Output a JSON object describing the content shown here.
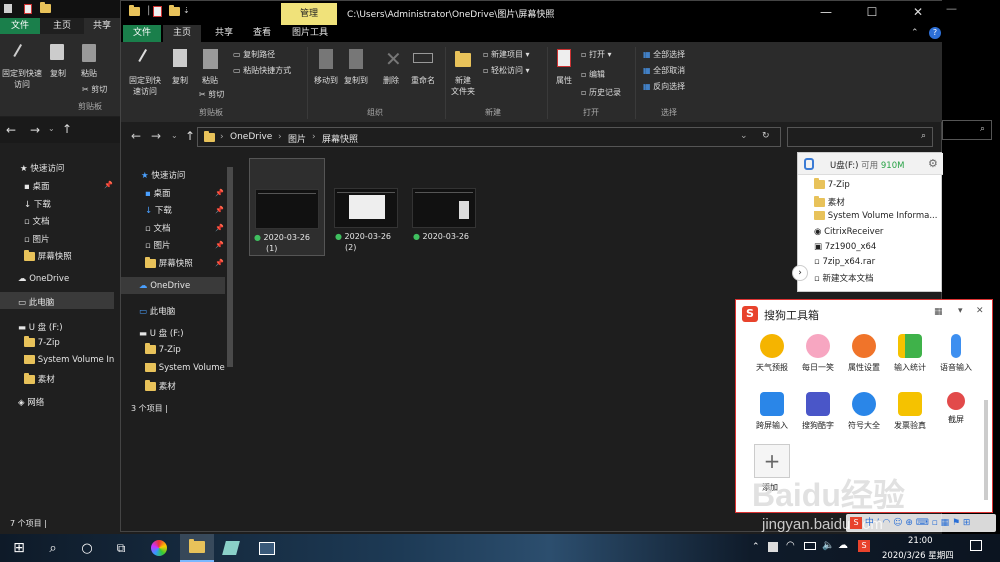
{
  "bg_window": {
    "tabs": [
      "文件",
      "主页",
      "共享"
    ],
    "ribbon": {
      "pin": "固定到快速访问",
      "copy": "复制",
      "paste": "粘贴",
      "cut": "剪切",
      "group": "剪贴板"
    },
    "nav": [
      "快速访问",
      "桌面",
      "下载",
      "文档",
      "图片",
      "屏幕快照",
      "OneDrive",
      "此电脑",
      "U 盘 (F:)",
      "7-Zip",
      "System Volume In",
      "素材",
      "网络"
    ],
    "status": "7 个项目"
  },
  "window": {
    "manage_tab": "管理",
    "path_title": "C:\\Users\\Administrator\\OneDrive\\图片\\屏幕快照",
    "tabs": [
      "文件",
      "主页",
      "共享",
      "查看",
      "图片工具"
    ],
    "ribbon": {
      "pin_l1": "固定到快",
      "pin_l2": "速访问",
      "copy": "复制",
      "paste": "粘贴",
      "copy_path": "复制路径",
      "paste_shortcut": "粘贴快捷方式",
      "cut": "剪切",
      "clipboard": "剪贴板",
      "move_to": "移动到",
      "copy_to": "复制到",
      "delete": "删除",
      "rename": "重命名",
      "organize": "组织",
      "new_folder_l1": "新建",
      "new_folder_l2": "文件夹",
      "new_item": "新建项目",
      "easy_access": "轻松访问",
      "new": "新建",
      "properties": "属性",
      "open": "打开",
      "edit": "编辑",
      "history": "历史记录",
      "open_group": "打开",
      "select_all": "全部选择",
      "select_none": "全部取消",
      "invert": "反向选择",
      "select": "选择"
    },
    "breadcrumb": [
      "OneDrive",
      "图片",
      "屏幕快照"
    ],
    "nav": {
      "quick_access": "快速访问",
      "desktop": "桌面",
      "downloads": "下载",
      "documents": "文档",
      "pictures": "图片",
      "screenshots": "屏幕快照",
      "onedrive": "OneDrive",
      "this_pc": "此电脑",
      "udisk": "U 盘 (F:)",
      "zip": "7-Zip",
      "sysvol": "System Volume",
      "sucai": "素材"
    },
    "files": [
      {
        "name": "2020-03-26",
        "sub": "(1)"
      },
      {
        "name": "2020-03-26",
        "sub": "(2)"
      },
      {
        "name": "2020-03-26",
        "sub": ""
      }
    ],
    "status": "3 个项目"
  },
  "usb_panel": {
    "title": "U盘(F:)",
    "avail_label": "可用",
    "avail": "910M",
    "items": [
      "7-Zip",
      "素材",
      "System Volume Informa...",
      "CitrixReceiver",
      "7z1900_x64",
      "7zip_x64.rar",
      "新建文本文档"
    ]
  },
  "sogou": {
    "title": "搜狗工具箱",
    "tools": [
      "天气预报",
      "每日一笑",
      "属性设置",
      "输入统计",
      "语音输入",
      "跨屏输入",
      "搜狗酷字",
      "符号大全",
      "发票验真",
      "截屏"
    ],
    "add": "添加"
  },
  "watermark": {
    "brand": "Baidu经验",
    "url": "jingyan.baidu.com"
  },
  "taskbar": {
    "time": "21:00",
    "date": "2020/3/26 星期四"
  },
  "colors": {
    "accent": "#1a7f4b",
    "manage": "#f0e27a",
    "selection": "#3a3a3a",
    "ribbon_bg": "#2b2b2b"
  }
}
